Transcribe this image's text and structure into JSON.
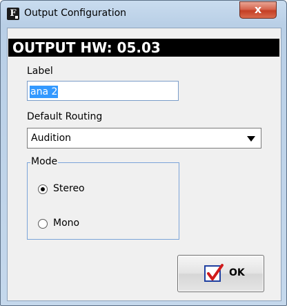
{
  "window": {
    "title": "Output Configuration",
    "app_icon_letter": "F",
    "close_glyph": "x"
  },
  "header": {
    "text": "OUTPUT HW: 05.03"
  },
  "label_field": {
    "label": "Label",
    "value": "ana 2"
  },
  "routing": {
    "label": "Default Routing",
    "selected": "Audition"
  },
  "mode": {
    "legend": "Mode",
    "options": [
      {
        "label": "Stereo",
        "checked": true
      },
      {
        "label": "Mono",
        "checked": false
      }
    ]
  },
  "ok_button": {
    "label": "OK",
    "icon": "red-checkmark-icon"
  },
  "colors": {
    "selection": "#3399ff",
    "header_bg": "#000000",
    "check": "#d01c1c"
  }
}
